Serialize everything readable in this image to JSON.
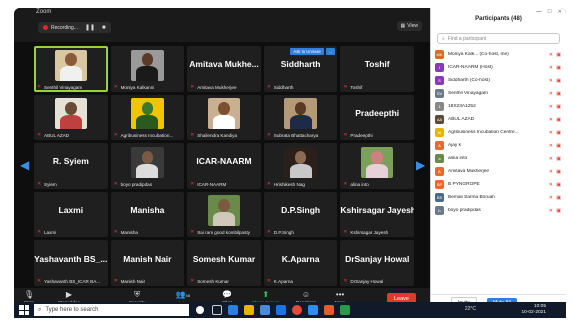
{
  "window": {
    "title": "Zoom",
    "recording_label": "Recording...",
    "view_label": "View"
  },
  "grid": [
    {
      "big": "",
      "small": "Senthil Vinayagam",
      "active": true,
      "photo": {
        "bg": "#d8c7a0",
        "skin": "#8a5a3b",
        "shirt": "#f0f0f0"
      }
    },
    {
      "big": "",
      "small": "Moniya Kalkanni",
      "photo": {
        "bg": "#9a9a9a",
        "skin": "#5c3a28",
        "shirt": "#1a1a1a"
      }
    },
    {
      "big": "Amitava  Mukhe...",
      "small": "Amitava Mukherjee"
    },
    {
      "big": "Siddharth",
      "small": "Siddharth",
      "buttons": [
        "Ask to Unmute",
        "..."
      ]
    },
    {
      "big": "Toshif",
      "small": "Toshif"
    },
    {
      "big": "",
      "small": "ABUL AZAD",
      "photo": {
        "bg": "#e6e1d6",
        "skin": "#6b4a33",
        "shirt": "#c04040"
      }
    },
    {
      "big": "",
      "small": "Agribusiness Incubation...",
      "photo": {
        "bg": "#f3c400",
        "skin": "#3a7a30",
        "shirt": "#2a5a20"
      }
    },
    {
      "big": "",
      "small": "Shailendra Kandiya",
      "photo": {
        "bg": "#c8b090",
        "skin": "#7a5030",
        "shirt": "#ffffff"
      }
    },
    {
      "big": "",
      "small": "Subrata Bhattacharya",
      "photo": {
        "bg": "#b59a78",
        "skin": "#5a3a24",
        "shirt": "#1e2a4a"
      }
    },
    {
      "big": "Pradeepthi",
      "small": "Pradeepthi"
    },
    {
      "big": "R. Syiem",
      "small": "Syiem"
    },
    {
      "big": "",
      "small": "boyo pradipdas",
      "photo": {
        "bg": "#3a3a3a",
        "skin": "#7a5a44",
        "shirt": "#dcdcdc"
      }
    },
    {
      "big": "ICAR-NAARM",
      "small": "ICAR-NAARM"
    },
    {
      "big": "",
      "small": "Hrishikesh Nag",
      "photo": {
        "bg": "#2a1f1a",
        "skin": "#8a6a50",
        "shirt": "#c8c8c8"
      }
    },
    {
      "big": "",
      "small": "alina into",
      "photo": {
        "bg": "#7aa05a",
        "skin": "#d08080",
        "shirt": "#e8d0d8"
      }
    },
    {
      "big": "Laxmi",
      "small": "Laxmi"
    },
    {
      "big": "Manisha",
      "small": "Manisha"
    },
    {
      "big": "",
      "small": "Sai ram good kombilposty",
      "photo": {
        "bg": "#6a8a4a",
        "skin": "#7a5a40",
        "shirt": "#d0c8b8"
      }
    },
    {
      "big": "D.P.Singh",
      "small": "D.P.Singh"
    },
    {
      "big": "Kshirsagar  Jayesh",
      "small": "Kshirsagar Jayesh"
    },
    {
      "big": "Yashavanth  BS_...",
      "small": "Yashavanth BS_ICAR BA..."
    },
    {
      "big": "Manish  Nair",
      "small": "Manish Nair"
    },
    {
      "big": "Somesh  Kumar",
      "small": "Somesh Kumar"
    },
    {
      "big": "K.Aparna",
      "small": "K.Aparna"
    },
    {
      "big": "DrSanjay  Howal",
      "small": "DrSanjay Howal"
    }
  ],
  "toolbar": {
    "mute": "Mute",
    "stop_video": "Stop Video",
    "security": "Security",
    "participants": "Participants",
    "participants_count": "48",
    "chat": "Chat",
    "share_screen": "Share Screen",
    "reactions": "Reactions",
    "more": "More",
    "leave": "Leave"
  },
  "panel": {
    "title": "Participants (48)",
    "search_placeholder": "Find a participant",
    "participants": [
      {
        "initials": "MK",
        "color": "#d86a2a",
        "name": "Moniya Kalk...  (Co-host, me)"
      },
      {
        "initials": "I",
        "color": "#8a3ab8",
        "name": "ICAR-NAARM (Host)"
      },
      {
        "initials": "S",
        "color": "#8a3ab8",
        "name": "Siddharth (Co-host)"
      },
      {
        "initials": "SV",
        "color": "#6a7a8a",
        "name": "Senthil Vinayagam"
      },
      {
        "initials": "1",
        "color": "#888888",
        "name": "18X23A1252"
      },
      {
        "initials": "AA",
        "color": "#5a4a3a",
        "name": "ABUL AZAD"
      },
      {
        "initials": "AI",
        "color": "#e8b400",
        "name": "Agribusiness Incubation Centre..."
      },
      {
        "initials": "A",
        "color": "#e86a2a",
        "name": "Ajay k"
      },
      {
        "initials": "a",
        "color": "#6a8a4a",
        "name": "alina into"
      },
      {
        "initials": "A",
        "color": "#e86a2a",
        "name": "Amitava Mukherjee"
      },
      {
        "initials": "BP",
        "color": "#e86a2a",
        "name": "B PYNGROPE"
      },
      {
        "initials": "BS",
        "color": "#4a6a8a",
        "name": "Bemali Sarma Boruah"
      },
      {
        "initials": "b",
        "color": "#6a7a8a",
        "name": "boyo pradipdas"
      }
    ],
    "invite_label": "Invite",
    "mute_all_label": "Mute All"
  },
  "taskbar": {
    "search_placeholder": "Type here to search",
    "temperature": "22°C",
    "time": "10:05",
    "date": "10-02-2021"
  }
}
